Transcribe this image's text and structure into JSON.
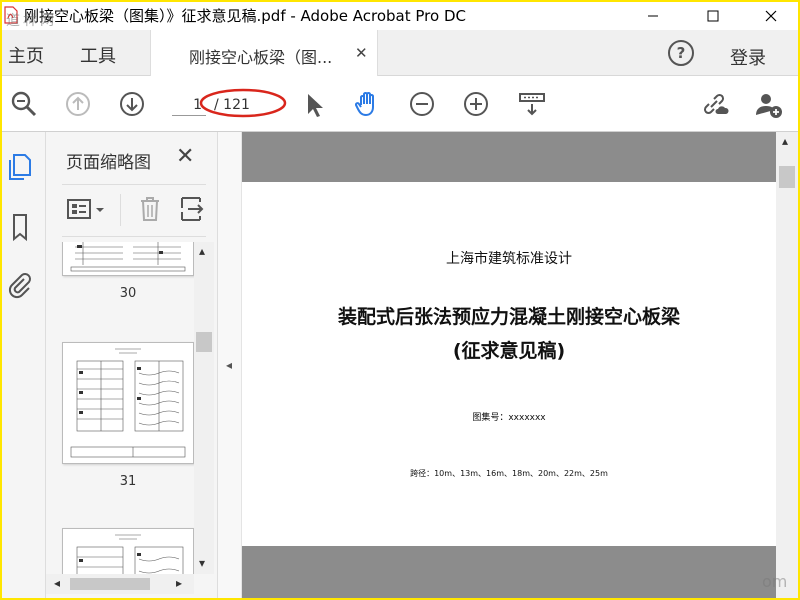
{
  "window": {
    "title": "刚接空心板梁（图集）》征求意见稿.pdf - Adobe Acrobat Pro DC",
    "watermark": "道林网",
    "corner_watermark": "om"
  },
  "tabbar": {
    "home": "主页",
    "tools": "工具",
    "doc_tab": "刚接空心板梁（图...",
    "signin": "登录",
    "help": "?"
  },
  "toolbar": {
    "page_current": "1",
    "page_total": "/ 121"
  },
  "thumbnails": {
    "header": "页面缩略图",
    "pages": [
      "30",
      "31"
    ]
  },
  "document": {
    "line1": "上海市建筑标准设计",
    "title_line1": "装配式后张法预应力混凝土刚接空心板梁",
    "title_line2": "(征求意见稿)",
    "atlas_no": "图集号：xxxxxxx",
    "spans": "跨径：10m、13m、16m、18m、20m、22m、25m"
  },
  "colors": {
    "accent": "#2c7be5",
    "annotation": "#d9261c",
    "border": "#ffe600"
  }
}
